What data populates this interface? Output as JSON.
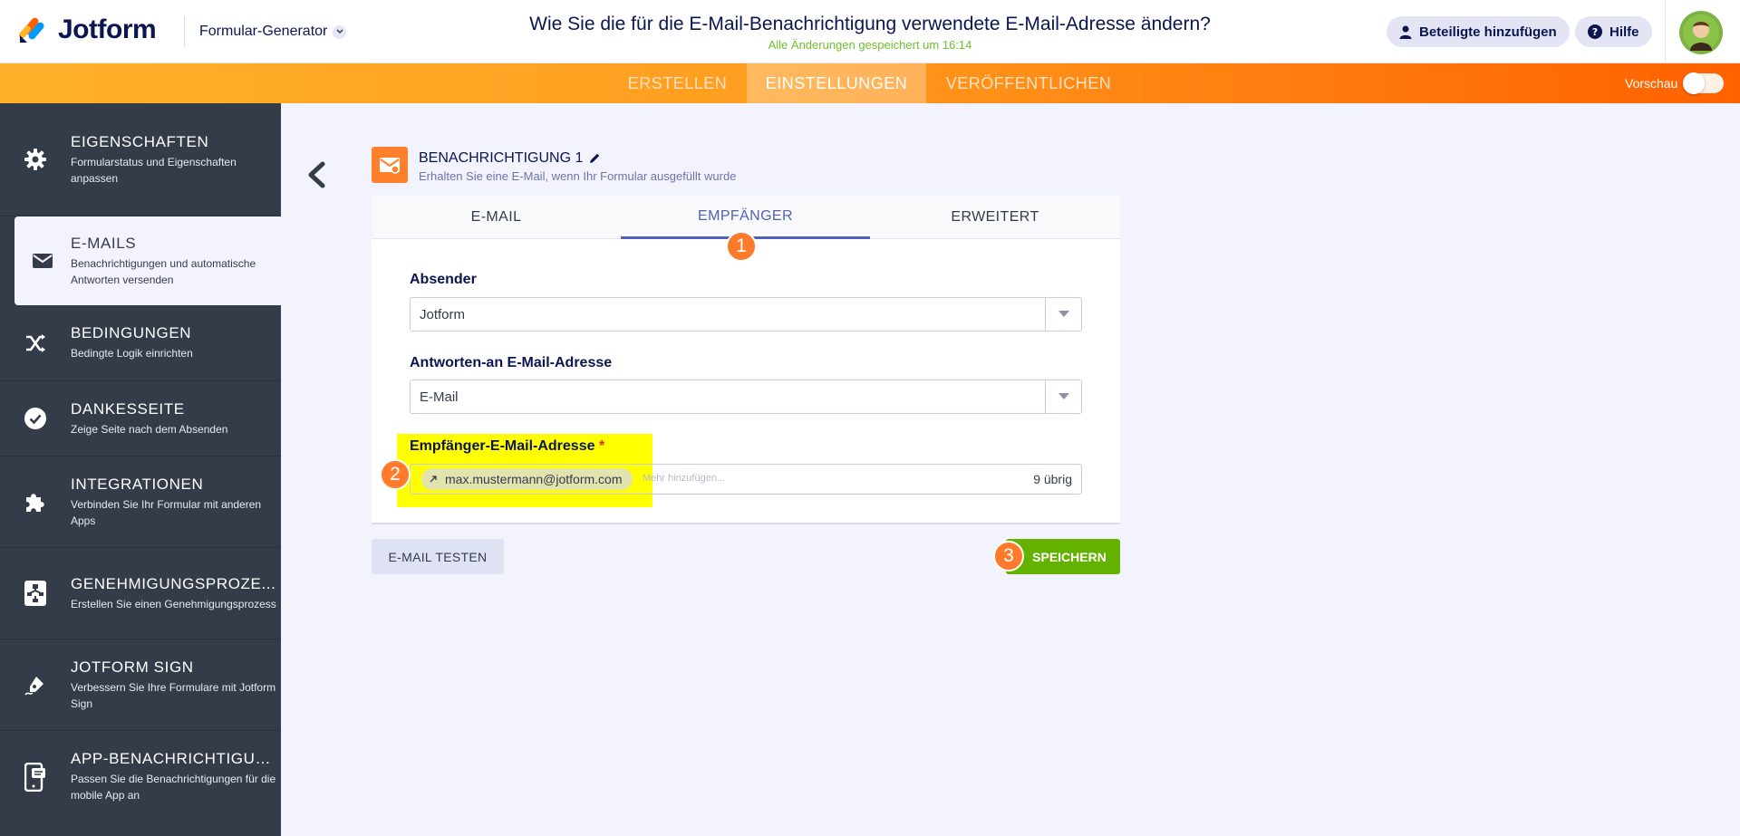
{
  "header": {
    "logo_text": "Jotform",
    "builder_label": "Formular-Generator",
    "title": "Wie Sie die für die E-Mail-Benachrichtigung verwendete E-Mail-Adresse ändern?",
    "save_status": "Alle Änderungen gespeichert um 16:14",
    "add_participants": "Beteiligte hinzufügen",
    "help": "Hilfe"
  },
  "nav": {
    "tabs": [
      "ERSTELLEN",
      "EINSTELLUNGEN",
      "VERÖFFENTLICHEN"
    ],
    "active": "EINSTELLUNGEN",
    "preview_label": "Vorschau"
  },
  "sidebar": {
    "items": [
      {
        "title": "EIGENSCHAFTEN",
        "sub": "Formularstatus und Eigenschaften anpassen",
        "icon": "gear-icon"
      },
      {
        "title": "E-MAILS",
        "sub": "Benachrichtigungen und automatische Antworten versenden",
        "icon": "envelope-icon"
      },
      {
        "title": "BEDINGUNGEN",
        "sub": "Bedingte Logik einrichten",
        "icon": "shuffle-icon"
      },
      {
        "title": "DANKESSEITE",
        "sub": "Zeige Seite nach dem Absenden",
        "icon": "check-circle-icon"
      },
      {
        "title": "INTEGRATIONEN",
        "sub": "Verbinden Sie Ihr Formular mit anderen Apps",
        "icon": "puzzle-icon"
      },
      {
        "title": "GENEHMIGUNGSPROZE...",
        "sub": "Erstellen Sie einen Genehmigungsprozess",
        "icon": "flow-icon"
      },
      {
        "title": "JOTFORM SIGN",
        "sub": "Verbessern Sie Ihre Formulare mit Jotform Sign",
        "icon": "pen-icon"
      },
      {
        "title": "APP-BENACHRICHTIGUNG",
        "sub": "Passen Sie die Benachrichtigungen für die mobile App an",
        "icon": "mobile-icon"
      }
    ]
  },
  "notification": {
    "title": "BENACHRICHTIGUNG 1",
    "subtitle": "Erhalten Sie eine E-Mail, wenn Ihr Formular ausgefüllt wurde"
  },
  "tabs": [
    "E-MAIL",
    "EMPFÄNGER",
    "ERWEITERT"
  ],
  "active_tab": "EMPFÄNGER",
  "form": {
    "sender_label": "Absender",
    "sender_value": "Jotform",
    "reply_label": "Antworten-an E-Mail-Adresse",
    "reply_value": "E-Mail",
    "recipient_label": "Empfänger-E-Mail-Adresse",
    "required_mark": "*",
    "recipient_tag": "max.mustermann@jotform.com",
    "more_placeholder": "Mehr hinzufügen...",
    "remaining": "9 übrig"
  },
  "buttons": {
    "test_email": "E-MAIL TESTEN",
    "save": "SPEICHERN"
  },
  "badges": [
    "1",
    "2",
    "3"
  ],
  "colors": {
    "orange": "#ff7a2a",
    "green": "#64b200",
    "highlight": "#ffff00",
    "tab_active": "#4e62b8",
    "sidebar": "#343c4a"
  }
}
